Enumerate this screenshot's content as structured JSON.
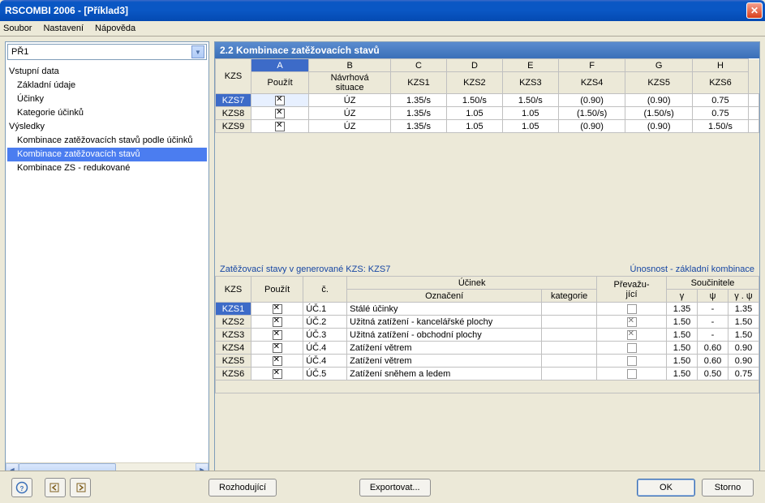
{
  "window": {
    "title": "RSCOMBI 2006 - [Příklad3]"
  },
  "menu": {
    "file": "Soubor",
    "settings": "Nastavení",
    "help": "Nápověda"
  },
  "combo": {
    "value": "PŘ1"
  },
  "tree": {
    "input": "Vstupní data",
    "i1": "Základní údaje",
    "i2": "Účinky",
    "i3": "Kategorie účinků",
    "results": "Výsledky",
    "r1": "Kombinace zatěžovacích stavů podle účinků",
    "r2": "Kombinace zatěžovacích stavů",
    "r3": "Kombinace ZS - redukované"
  },
  "panel": {
    "title": "2.2 Kombinace zatěžovacích stavů"
  },
  "top_table": {
    "letters": [
      "A",
      "B",
      "C",
      "D",
      "E",
      "F",
      "G",
      "H"
    ],
    "rowheader": "KZS",
    "cols": {
      "use": "Použít\t",
      "sit": "Návrhová\nsituace",
      "k1": "KZS1",
      "k2": "KZS2",
      "k3": "KZS3",
      "k4": "KZS4",
      "k5": "KZS5",
      "k6": "KZS6"
    },
    "rows": [
      {
        "id": "KZS7",
        "use": true,
        "sit": "ÚZ",
        "c": [
          "1.35/s",
          "1.50/s",
          "1.50/s",
          "(0.90)",
          "(0.90)",
          "0.75"
        ]
      },
      {
        "id": "KZS8",
        "use": true,
        "sit": "ÚZ",
        "c": [
          "1.35/s",
          "1.05",
          "1.05",
          "(1.50/s)",
          "(1.50/s)",
          "0.75"
        ]
      },
      {
        "id": "KZS9",
        "use": true,
        "sit": "ÚZ",
        "c": [
          "1.35/s",
          "1.05",
          "1.05",
          "(0.90)",
          "(0.90)",
          "1.50/s"
        ]
      }
    ]
  },
  "sub": {
    "left": "Zatěžovací stavy v generované KZS: KZS7",
    "right": "Únosnost - základní kombinace"
  },
  "bot_table": {
    "rowheader": "KZS",
    "hdr": {
      "use": "Použít",
      "c": "č.",
      "effect": "Účinek",
      "design": "Označení",
      "cat": "kategorie",
      "prev": "Převažu-\njící",
      "coef": "Součinitele",
      "g": "γ",
      "psi": "ψ",
      "gpsi": "γ . ψ"
    },
    "rows": [
      {
        "id": "KZS1",
        "use": true,
        "c": "ÚČ.1",
        "d": "Stálé účinky",
        "cat": "",
        "pv": "empty",
        "g": "1.35",
        "p": "-",
        "gp": "1.35"
      },
      {
        "id": "KZS2",
        "use": true,
        "c": "ÚČ.2",
        "d": "Užitná zatížení - kancelářské plochy",
        "cat": "",
        "pv": "x",
        "g": "1.50",
        "p": "-",
        "gp": "1.50"
      },
      {
        "id": "KZS3",
        "use": true,
        "c": "ÚČ.3",
        "d": "Užitná zatížení - obchodní plochy",
        "cat": "",
        "pv": "x",
        "g": "1.50",
        "p": "-",
        "gp": "1.50"
      },
      {
        "id": "KZS4",
        "use": true,
        "c": "ÚČ.4",
        "d": "Zatížení větrem",
        "cat": "",
        "pv": "empty",
        "g": "1.50",
        "p": "0.60",
        "gp": "0.90"
      },
      {
        "id": "KZS5",
        "use": true,
        "c": "ÚČ.4",
        "d": "Zatížení větrem",
        "cat": "",
        "pv": "empty",
        "g": "1.50",
        "p": "0.60",
        "gp": "0.90"
      },
      {
        "id": "KZS6",
        "use": true,
        "c": "ÚČ.5",
        "d": "Zatížení sněhem a ledem",
        "cat": "",
        "pv": "empty",
        "g": "1.50",
        "p": "0.50",
        "gp": "0.75"
      }
    ]
  },
  "buttons": {
    "decide": "Rozhodující",
    "export": "Exportovat...",
    "ok": "OK",
    "cancel": "Storno"
  }
}
